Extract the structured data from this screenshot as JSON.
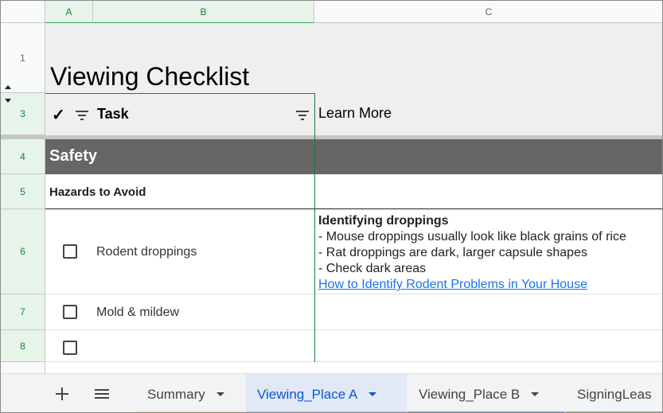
{
  "columns": [
    "A",
    "B",
    "C"
  ],
  "rows": [
    "1",
    "3",
    "4",
    "5",
    "6",
    "7",
    "8"
  ],
  "title": "Viewing Checklist",
  "header": {
    "check_mark": "✓",
    "task": "Task",
    "learn_more": "Learn More"
  },
  "section": {
    "label": "Safety"
  },
  "subsection": {
    "label": "Hazards to Avoid"
  },
  "tasks": [
    {
      "label": "Rodent droppings",
      "checked": false
    },
    {
      "label": "Mold & mildew",
      "checked": false
    },
    {
      "label": "",
      "checked": false
    }
  ],
  "learn": {
    "heading": "Identifying droppings",
    "lines": [
      "- Mouse droppings usually look like black grains of rice",
      "- Rat droppings are dark, larger capsule shapes",
      "- Check dark areas"
    ],
    "link": "How to Identify Rodent Problems in Your House"
  },
  "tabs": [
    {
      "label": "Summary",
      "color": "#fbbc04",
      "active": false
    },
    {
      "label": "Viewing_Place A",
      "color": "#4285f4",
      "active": true
    },
    {
      "label": "Viewing_Place B",
      "color": "#4285f4",
      "active": false
    },
    {
      "label": "SigningLeas",
      "color": "#34a853",
      "active": false
    }
  ],
  "icons": {
    "add": "plus-icon",
    "menu": "hamburger-menu-icon"
  }
}
